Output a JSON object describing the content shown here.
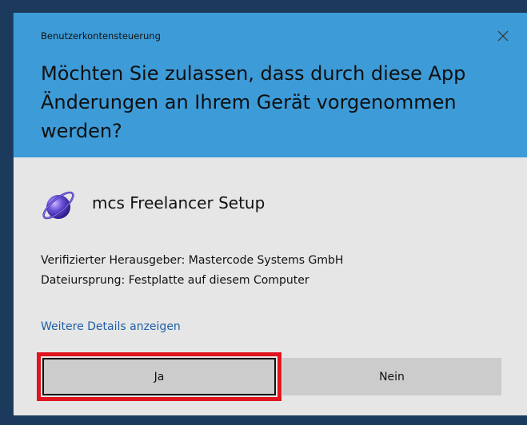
{
  "window": {
    "title": "Benutzerkontensteuerung",
    "close_icon": "close-icon"
  },
  "header": {
    "question": "Möchten Sie zulassen, dass durch diese App Änderungen an Ihrem Gerät vorgenommen werden?",
    "background_color": "#3d9bd8"
  },
  "app": {
    "icon": "globe-orbit-icon",
    "name": "mcs Freelancer Setup"
  },
  "info": {
    "publisher": "Verifizierter Herausgeber: Mastercode Systems GmbH",
    "origin": "Dateiursprung: Festplatte auf diesem Computer"
  },
  "details_link": "Weitere Details anzeigen",
  "buttons": {
    "yes": "Ja",
    "no": "Nein",
    "highlight_color": "#e0141e"
  }
}
